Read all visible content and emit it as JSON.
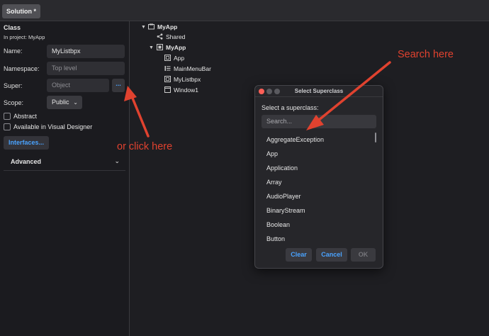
{
  "toolbar": {
    "tab_label": "Solution *"
  },
  "inspector": {
    "title": "Class",
    "subtitle": "In project: MyApp",
    "name_label": "Name:",
    "name_value": "MyListbpx",
    "namespace_label": "Namespace:",
    "namespace_placeholder": "Top level",
    "super_label": "Super:",
    "super_placeholder": "Object",
    "super_button_label": "...",
    "scope_label": "Scope:",
    "scope_value": "Public",
    "abstract_label": "Abstract",
    "visual_designer_label": "Available in Visual Designer",
    "interfaces_button": "Interfaces...",
    "advanced_label": "Advanced"
  },
  "tree": {
    "root": "MyApp",
    "shared": "Shared",
    "project": "MyApp",
    "children": [
      "App",
      "MainMenuBar",
      "MyListbpx",
      "Window1"
    ]
  },
  "dialog": {
    "title": "Select Superclass",
    "prompt": "Select a superclass:",
    "search_placeholder": "Search...",
    "items": [
      "AggregateException",
      "App",
      "Application",
      "Array",
      "AudioPlayer",
      "BinaryStream",
      "Boolean",
      "Button"
    ],
    "clear_button": "Clear",
    "cancel_button": "Cancel",
    "ok_button": "OK"
  },
  "annotations": {
    "search_here": "Search here",
    "or_click_here": "or click here",
    "color": "#e0422f"
  },
  "colors": {
    "accent": "#4aa3ff",
    "background": "#1e1e22"
  }
}
